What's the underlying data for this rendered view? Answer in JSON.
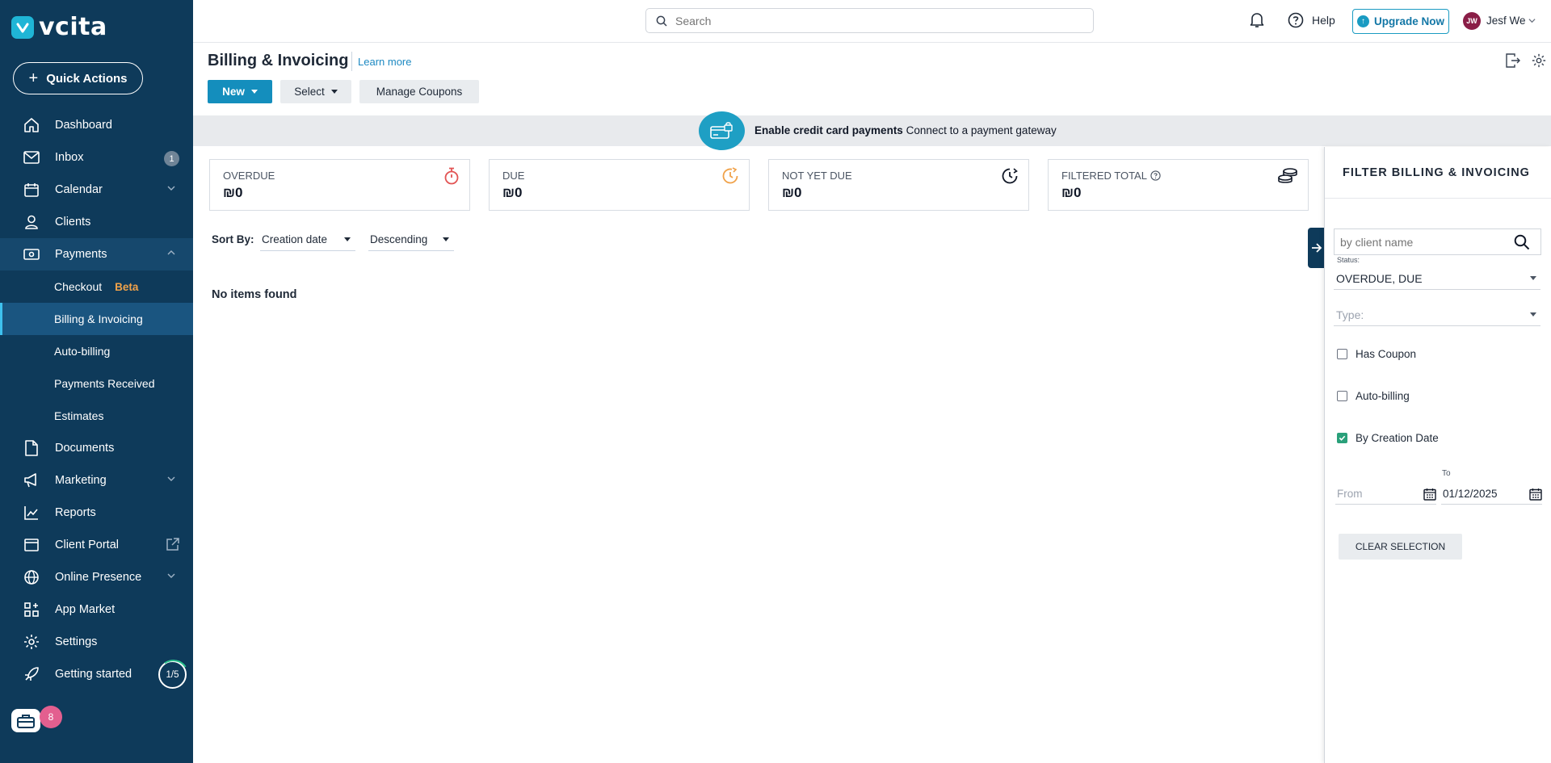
{
  "app": {
    "logo_text": "vcita"
  },
  "sidebar": {
    "quick_actions_label": "Quick Actions",
    "items": [
      {
        "label": "Dashboard",
        "icon": "home-icon"
      },
      {
        "label": "Inbox",
        "icon": "mail-icon",
        "badge": "1"
      },
      {
        "label": "Calendar",
        "icon": "calendar-icon"
      },
      {
        "label": "Clients",
        "icon": "person-icon"
      },
      {
        "label": "Payments",
        "icon": "payments-icon"
      },
      {
        "label": "Documents",
        "icon": "document-icon"
      },
      {
        "label": "Marketing",
        "icon": "megaphone-icon"
      },
      {
        "label": "Reports",
        "icon": "chart-icon"
      },
      {
        "label": "Client Portal",
        "icon": "portal-icon"
      },
      {
        "label": "Online Presence",
        "icon": "globe-icon"
      },
      {
        "label": "App Market",
        "icon": "apps-icon"
      },
      {
        "label": "Settings",
        "icon": "gear-icon"
      },
      {
        "label": "Getting started",
        "icon": "rocket-icon",
        "progress": "1/5"
      }
    ],
    "payments_sub": [
      {
        "label": "Checkout",
        "tag": "Beta"
      },
      {
        "label": "Billing & Invoicing"
      },
      {
        "label": "Auto-billing"
      },
      {
        "label": "Payments Received"
      },
      {
        "label": "Estimates"
      }
    ],
    "toolbox_badge": "8"
  },
  "topbar": {
    "search_placeholder": "Search",
    "help_label": "Help",
    "upgrade_label": "Upgrade Now",
    "user_initials": "JW",
    "user_name": "Jesf We"
  },
  "page": {
    "title": "Billing & Invoicing",
    "learn_more": "Learn more",
    "buttons": {
      "new": "New",
      "select": "Select",
      "manage_coupons": "Manage Coupons"
    }
  },
  "banner": {
    "bold": "Enable credit card payments",
    "text": "Connect to a payment gateway"
  },
  "cards": [
    {
      "label": "OVERDUE",
      "value": "₪0",
      "icon": "stopwatch-icon",
      "color": "#e25454"
    },
    {
      "label": "DUE",
      "value": "₪0",
      "icon": "clock-icon",
      "color": "#f0a24a"
    },
    {
      "label": "NOT YET DUE",
      "value": "₪0",
      "icon": "clock-refresh-icon",
      "color": "#111827"
    },
    {
      "label": "FILTERED TOTAL",
      "value": "₪0",
      "icon": "coins-icon",
      "color": "#111827"
    }
  ],
  "sort": {
    "label": "Sort By:",
    "field": "Creation date",
    "order": "Descending"
  },
  "empty_text": "No items found",
  "filter": {
    "title": "FILTER BILLING & INVOICING",
    "client_placeholder": "by client name",
    "status_label": "Status:",
    "status_value": "OVERDUE, DUE",
    "type_placeholder": "Type:",
    "has_coupon": "Has Coupon",
    "auto_billing": "Auto-billing",
    "by_creation_date": "By Creation Date",
    "by_creation_date_checked": true,
    "to_label": "To",
    "from_placeholder": "From",
    "to_value": "01/12/2025",
    "clear_label": "CLEAR SELECTION"
  },
  "colors": {
    "sidebar_bg": "#0e3a5a",
    "accent": "#148ebd",
    "beta": "#f0a24a",
    "check": "#2aa07a"
  }
}
